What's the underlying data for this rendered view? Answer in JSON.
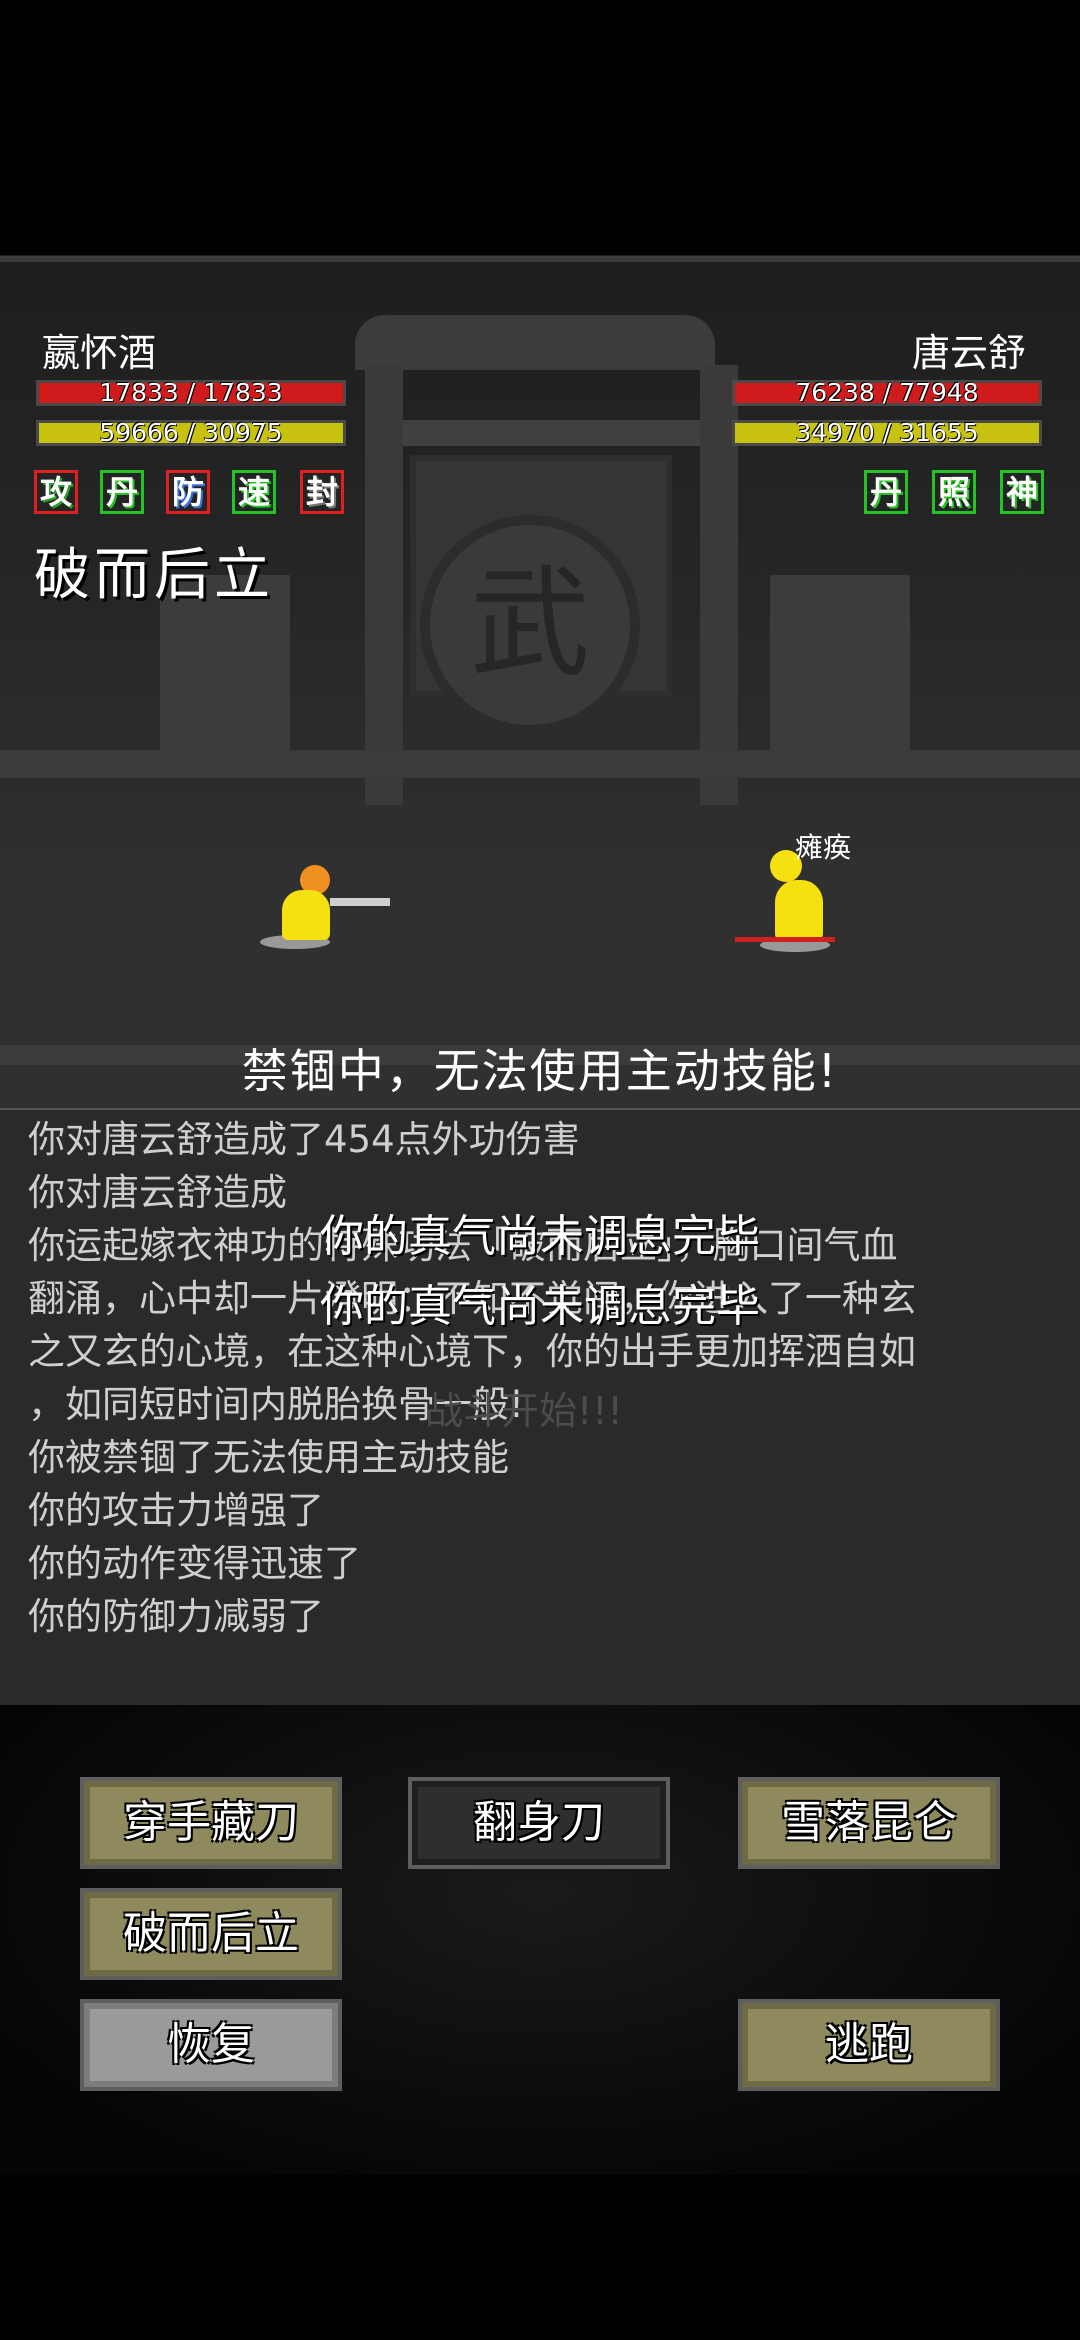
{
  "player": {
    "name": "嬴怀酒",
    "hp_text": "17833 / 17833",
    "mp_text": "59666 / 30975",
    "statuses": [
      "攻",
      "丹",
      "防",
      "速",
      "封"
    ],
    "active_skill": "破而后立"
  },
  "enemy": {
    "name": "唐云舒",
    "hp_text": "76238 / 77948",
    "mp_text": "34970 / 31655",
    "statuses": [
      "丹",
      "照",
      "神"
    ],
    "debuff": "瘫痪"
  },
  "arena": {
    "seal_char": "武",
    "warning": "禁锢中，无法使用主动技能!"
  },
  "log": {
    "lines": [
      "你对唐云舒造成了454点外功伤害",
      "你对唐云舒造成",
      "你运起嫁衣神功的特殊功法「破而后立」，胸口间气血",
      "翻涌，心中却一片澄明：不知不觉间，你进入了一种玄",
      "之又玄的心境，在这种心境下，你的出手更加挥洒自如",
      "，如同短时间内脱胎换骨一般!",
      "你被禁锢了无法使用主动技能",
      "你的攻击力增强了",
      "你的动作变得迅速了",
      "你的防御力减弱了"
    ],
    "faint_text": "战斗开始!!!",
    "toast_1": "你的真气尚未调息完毕",
    "toast_2": "你的真气尚未调息完毕"
  },
  "skills": {
    "skill_1": "穿手藏刀",
    "skill_2": "翻身刀",
    "skill_3": "雪落昆仑",
    "skill_4": "破而后立",
    "recover": "恢复",
    "flee": "逃跑"
  }
}
